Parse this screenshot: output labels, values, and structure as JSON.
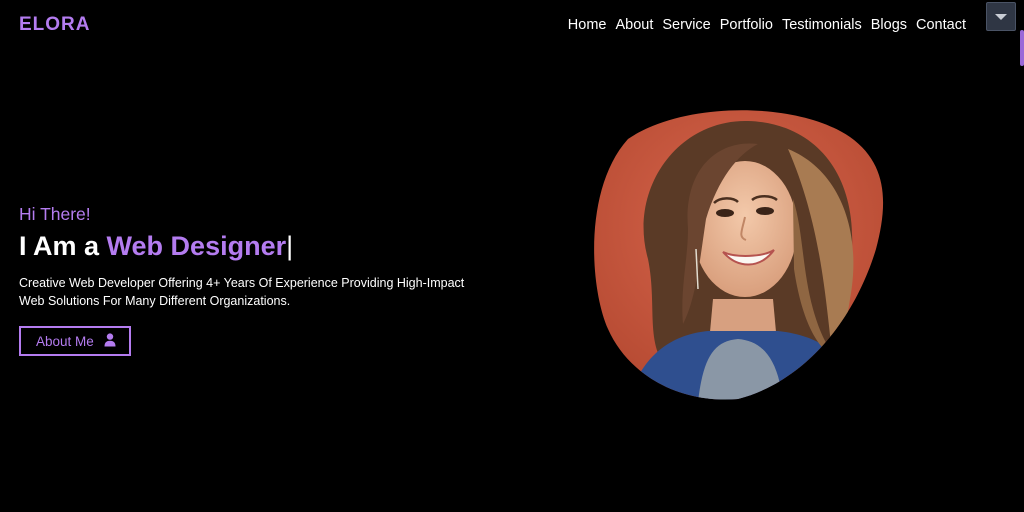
{
  "header": {
    "logo": "ELORA",
    "nav": [
      "Home",
      "About",
      "Service",
      "Portfolio",
      "Testimonials",
      "Blogs",
      "Contact"
    ],
    "menu_toggle_icon": "chevron-down-icon"
  },
  "hero": {
    "greeting": "Hi There!",
    "headline_prefix": "I Am a",
    "headline_role": "Web Designer",
    "cursor": "|",
    "description_line1": "Creative Web Developer Offering 4+ Years Of Experience Providing High-Impact",
    "description_line2": "Web Solutions For Many Different Organizations.",
    "button_label": "About Me",
    "button_icon": "user-icon"
  },
  "colors": {
    "background": "#000000",
    "accent": "#b47cf0",
    "text": "#ffffff",
    "photo_backdrop": "#c95b45"
  }
}
